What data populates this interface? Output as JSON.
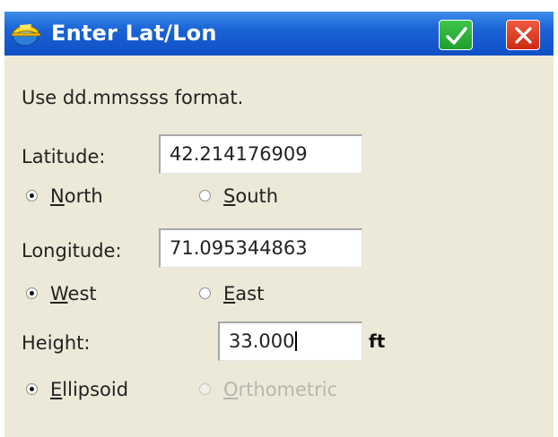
{
  "window": {
    "title": "Enter Lat/Lon",
    "icon": "hardhat-globe-icon"
  },
  "titlebar_buttons": {
    "ok_icon": "checkmark-icon",
    "close_icon": "close-icon",
    "ok_color": "#27b036",
    "close_color": "#e0412a"
  },
  "instructions": "Use dd.mmssss format.",
  "latitude": {
    "label": "Latitude:",
    "value": "42.214176909",
    "options": [
      {
        "first": "N",
        "rest": "orth",
        "selected": true,
        "enabled": true
      },
      {
        "first": "S",
        "rest": "outh",
        "selected": false,
        "enabled": true
      }
    ]
  },
  "longitude": {
    "label": "Longitude:",
    "value": "71.095344863",
    "options": [
      {
        "first": "W",
        "rest": "est",
        "selected": true,
        "enabled": true
      },
      {
        "first": "E",
        "rest": "ast",
        "selected": false,
        "enabled": true
      }
    ]
  },
  "height": {
    "label": "Height:",
    "value": "33.000",
    "unit": "ft",
    "options": [
      {
        "first": "E",
        "rest": "llipsoid",
        "selected": true,
        "enabled": true
      },
      {
        "first": "O",
        "rest": "rthometric",
        "selected": false,
        "enabled": false
      }
    ]
  }
}
